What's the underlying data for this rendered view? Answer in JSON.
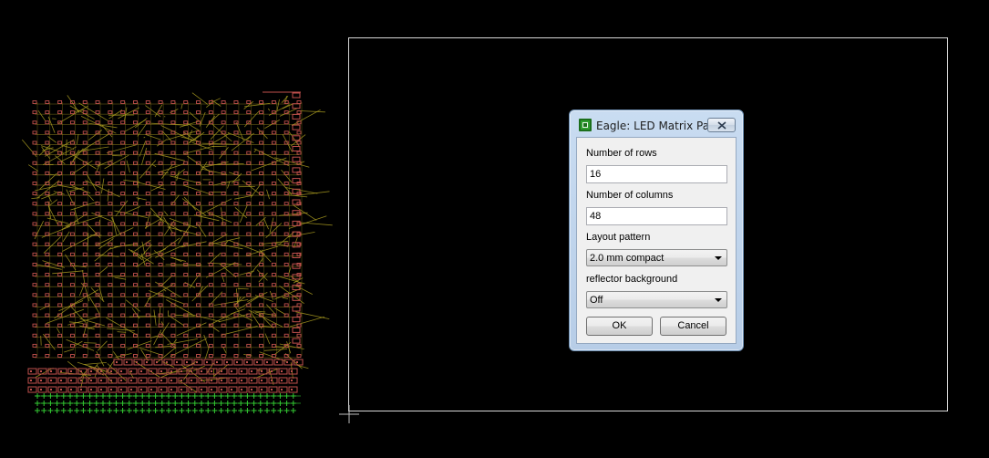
{
  "dialog": {
    "title": "Eagle: LED Matrix Par...",
    "rows_label": "Number of rows",
    "rows_value": "16",
    "columns_label": "Number of columns",
    "columns_value": "48",
    "layout_label": "Layout pattern",
    "layout_value": "2.0 mm compact",
    "reflector_label": "reflector background",
    "reflector_value": "Off",
    "ok_label": "OK",
    "cancel_label": "Cancel"
  },
  "colors": {
    "canvas_background": "#000000",
    "board_outline": "#d8d8d8",
    "pad_color": "#c0504d",
    "trace_color": "#a89a20",
    "via_color": "#33cc33"
  },
  "icons": {
    "app": "eagle-app-icon",
    "close": "close-icon",
    "dropdown": "chevron-down-icon",
    "origin": "crosshair-icon"
  }
}
